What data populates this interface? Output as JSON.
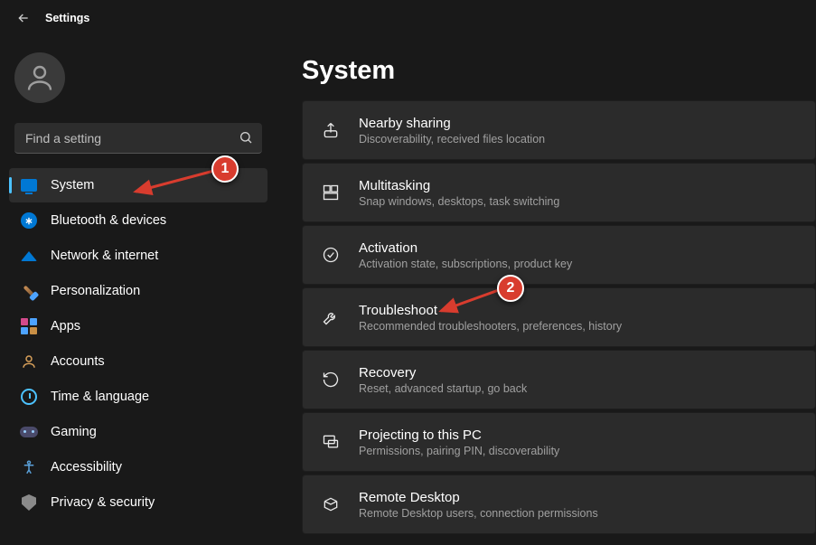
{
  "app": {
    "title": "Settings"
  },
  "search": {
    "placeholder": "Find a setting"
  },
  "sidebar": {
    "items": [
      {
        "label": "System"
      },
      {
        "label": "Bluetooth & devices"
      },
      {
        "label": "Network & internet"
      },
      {
        "label": "Personalization"
      },
      {
        "label": "Apps"
      },
      {
        "label": "Accounts"
      },
      {
        "label": "Time & language"
      },
      {
        "label": "Gaming"
      },
      {
        "label": "Accessibility"
      },
      {
        "label": "Privacy & security"
      }
    ]
  },
  "main": {
    "title": "System",
    "cards": [
      {
        "title": "Nearby sharing",
        "sub": "Discoverability, received files location"
      },
      {
        "title": "Multitasking",
        "sub": "Snap windows, desktops, task switching"
      },
      {
        "title": "Activation",
        "sub": "Activation state, subscriptions, product key"
      },
      {
        "title": "Troubleshoot",
        "sub": "Recommended troubleshooters, preferences, history"
      },
      {
        "title": "Recovery",
        "sub": "Reset, advanced startup, go back"
      },
      {
        "title": "Projecting to this PC",
        "sub": "Permissions, pairing PIN, discoverability"
      },
      {
        "title": "Remote Desktop",
        "sub": "Remote Desktop users, connection permissions"
      }
    ]
  },
  "annotations": {
    "callout1": "1",
    "callout2": "2"
  }
}
